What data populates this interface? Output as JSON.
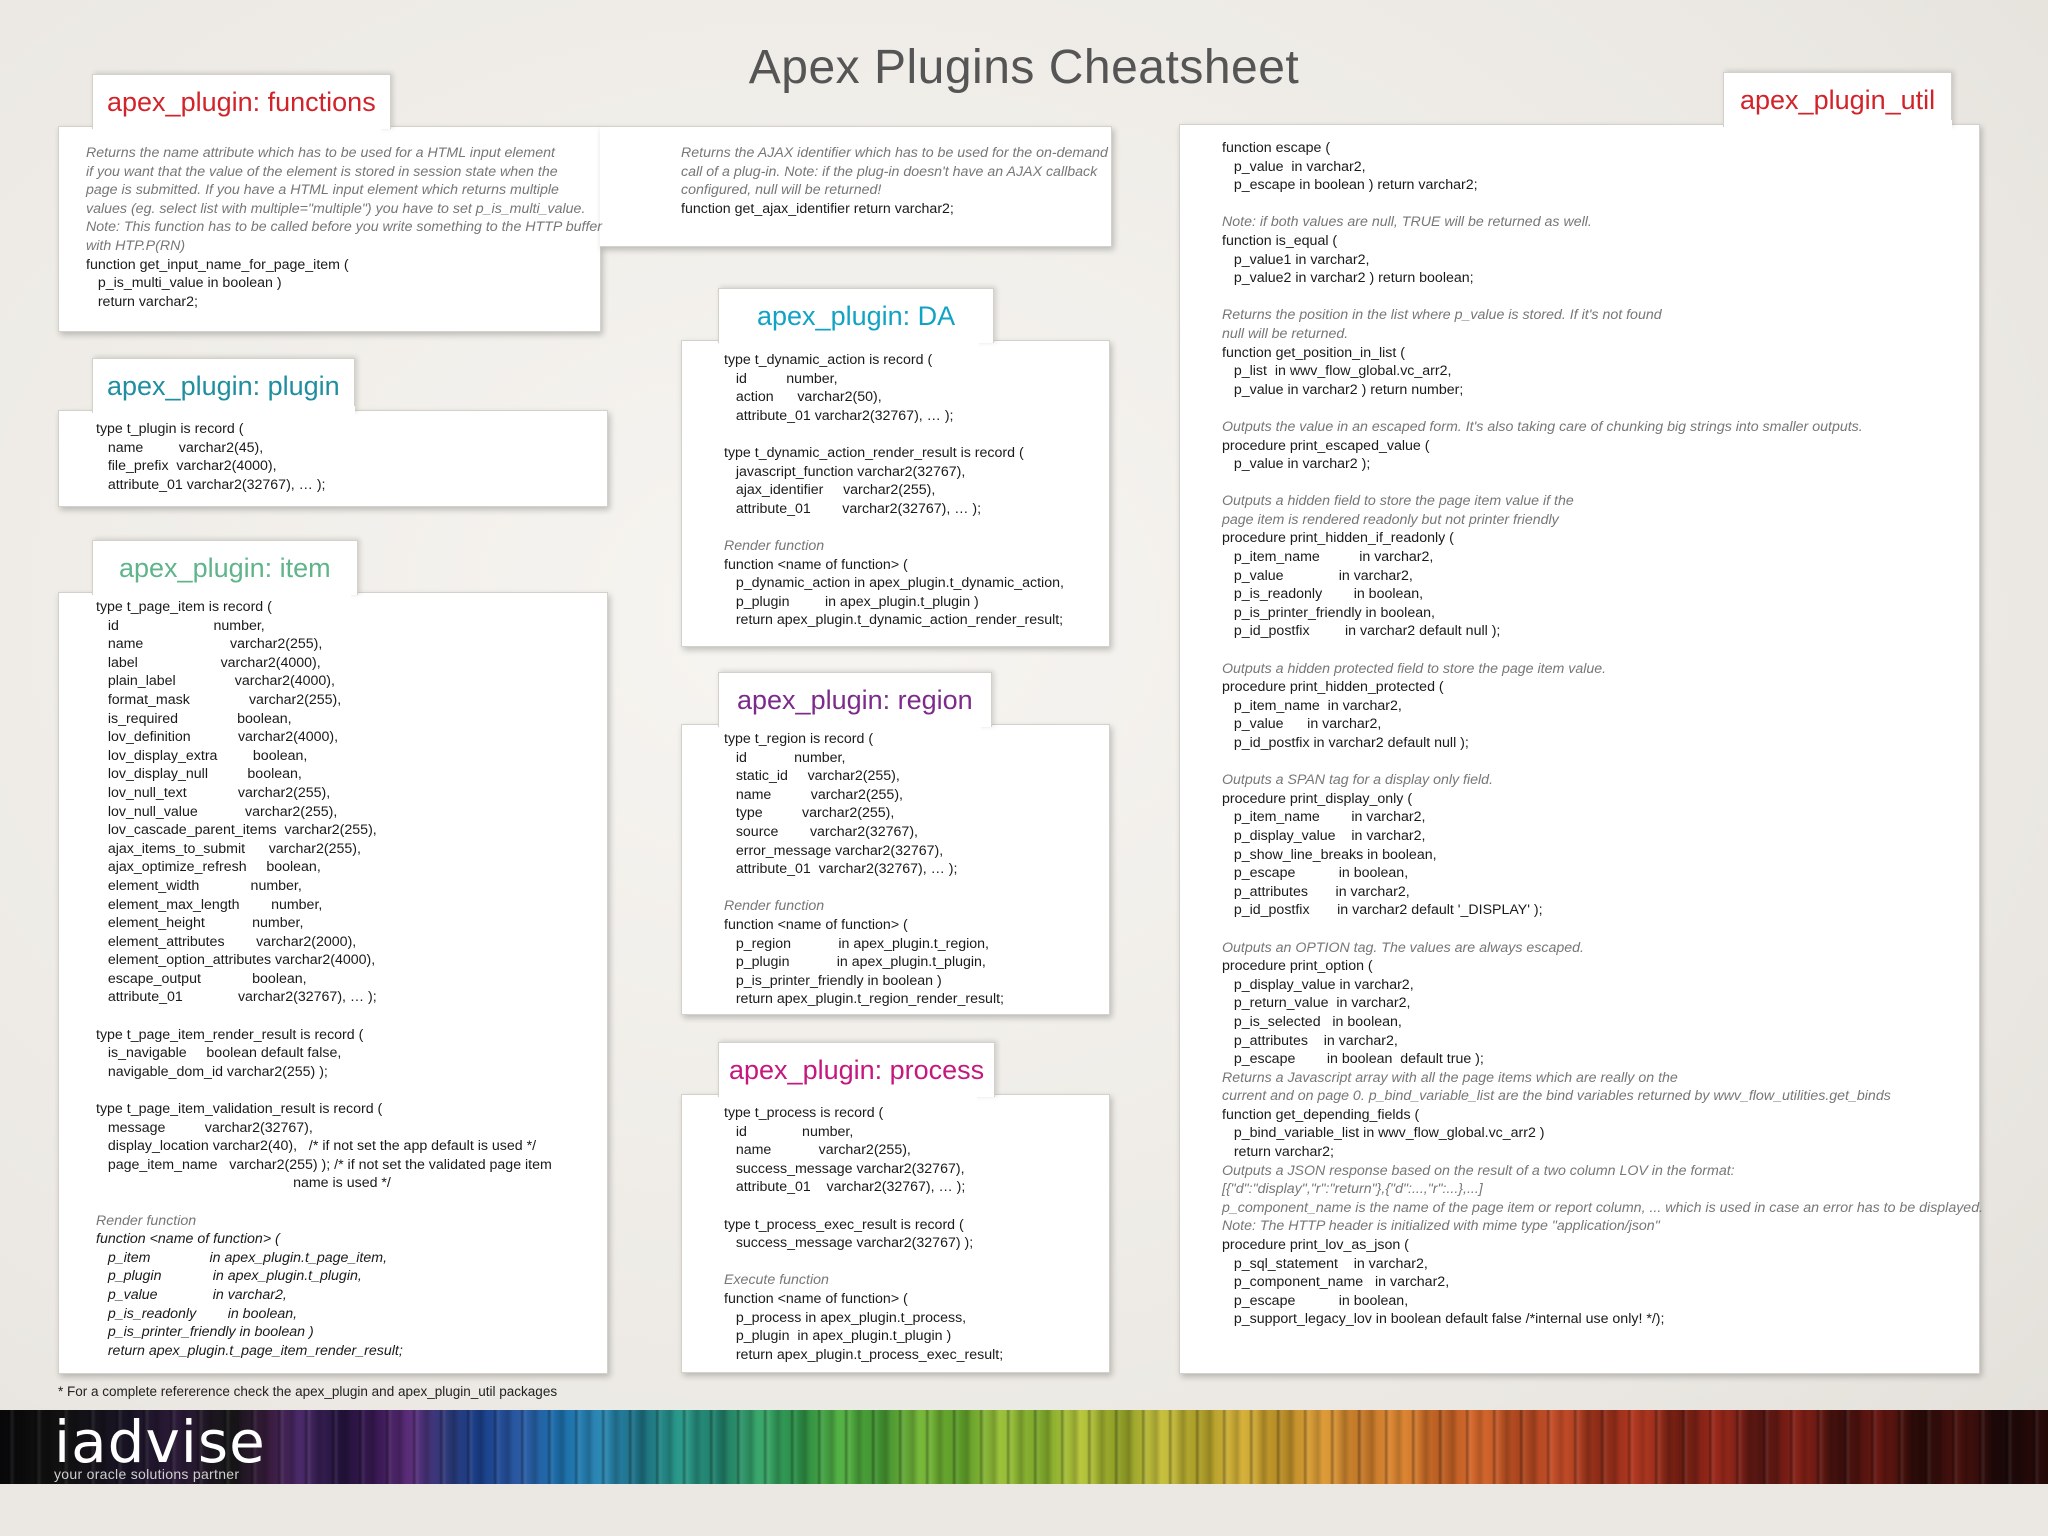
{
  "title": "Apex Plugins Cheatsheet",
  "colors": {
    "functions": "#d2232a",
    "plugin": "#1f8ea0",
    "item": "#5fb48a",
    "da": "#12a3c4",
    "region": "#7d2b8b",
    "process": "#c4187e",
    "util": "#d2232a"
  },
  "functions": {
    "tab": "apex_plugin: functions",
    "left_lines": [
      {
        "t": "Returns the name attribute which has to be used for a HTML input element",
        "s": "n"
      },
      {
        "t": "if you want that the value of the element is stored in session state when the",
        "s": "n"
      },
      {
        "t": "page is submitted. If you have a HTML input element which returns multiple",
        "s": "n"
      },
      {
        "t": "values (eg. select list with multiple=\"multiple\") you have to set p_is_multi_value.",
        "s": "n"
      },
      {
        "t": "Note: This function has to be called before you write something to the HTTP buffer",
        "s": "n"
      },
      {
        "t": "with HTP.P(RN)",
        "s": "n"
      },
      {
        "t": "function get_input_name_for_page_item (",
        "s": ""
      },
      {
        "t": "   p_is_multi_value in boolean )",
        "s": ""
      },
      {
        "t": "   return varchar2;",
        "s": ""
      }
    ],
    "right_lines": [
      {
        "t": "Returns the AJAX identifier which has to be used for the on-demand",
        "s": "n"
      },
      {
        "t": "call of a plug-in. Note: if the plug-in doesn't have an AJAX callback",
        "s": "n"
      },
      {
        "t": "configured, null will be returned!",
        "s": "n"
      },
      {
        "t": "function get_ajax_identifier return varchar2;",
        "s": ""
      }
    ]
  },
  "plugin": {
    "tab": "apex_plugin: plugin",
    "lines": [
      {
        "t": "type t_plugin is record (",
        "s": ""
      },
      {
        "t": "   name         varchar2(45),",
        "s": ""
      },
      {
        "t": "   file_prefix  varchar2(4000),",
        "s": ""
      },
      {
        "t": "   attribute_01 varchar2(32767), … );",
        "s": ""
      }
    ]
  },
  "item": {
    "tab": "apex_plugin: item",
    "lines": [
      {
        "t": "type t_page_item is record (",
        "s": ""
      },
      {
        "t": "   id                        number,",
        "s": ""
      },
      {
        "t": "   name                      varchar2(255),",
        "s": ""
      },
      {
        "t": "   label                     varchar2(4000),",
        "s": ""
      },
      {
        "t": "   plain_label               varchar2(4000),",
        "s": ""
      },
      {
        "t": "   format_mask               varchar2(255),",
        "s": ""
      },
      {
        "t": "   is_required               boolean,",
        "s": ""
      },
      {
        "t": "   lov_definition            varchar2(4000),",
        "s": ""
      },
      {
        "t": "   lov_display_extra         boolean,",
        "s": ""
      },
      {
        "t": "   lov_display_null          boolean,",
        "s": ""
      },
      {
        "t": "   lov_null_text             varchar2(255),",
        "s": ""
      },
      {
        "t": "   lov_null_value            varchar2(255),",
        "s": ""
      },
      {
        "t": "   lov_cascade_parent_items  varchar2(255),",
        "s": ""
      },
      {
        "t": "   ajax_items_to_submit      varchar2(255),",
        "s": ""
      },
      {
        "t": "   ajax_optimize_refresh     boolean,",
        "s": ""
      },
      {
        "t": "   element_width             number,",
        "s": ""
      },
      {
        "t": "   element_max_length        number,",
        "s": ""
      },
      {
        "t": "   element_height            number,",
        "s": ""
      },
      {
        "t": "   element_attributes        varchar2(2000),",
        "s": ""
      },
      {
        "t": "   element_option_attributes varchar2(4000),",
        "s": ""
      },
      {
        "t": "   escape_output             boolean,",
        "s": ""
      },
      {
        "t": "   attribute_01              varchar2(32767), … );",
        "s": ""
      },
      {
        "t": "",
        "s": ""
      },
      {
        "t": "type t_page_item_render_result is record (",
        "s": ""
      },
      {
        "t": "   is_navigable     boolean default false,",
        "s": ""
      },
      {
        "t": "   navigable_dom_id varchar2(255) );",
        "s": ""
      },
      {
        "t": "",
        "s": ""
      },
      {
        "t": "type t_page_item_validation_result is record (",
        "s": ""
      },
      {
        "t": "   message          varchar2(32767),",
        "s": ""
      },
      {
        "t": "   display_location varchar2(40),   /* if not set the app default is used */",
        "s": ""
      },
      {
        "t": "   page_item_name   varchar2(255) ); /* if not set the validated page item",
        "s": ""
      },
      {
        "t": "                                                  name is used */",
        "s": ""
      },
      {
        "t": "",
        "s": ""
      },
      {
        "t": "Render function",
        "s": "n"
      },
      {
        "t": "function <name of function> (",
        "s": "i"
      },
      {
        "t": "   p_item               in apex_plugin.t_page_item,",
        "s": "i"
      },
      {
        "t": "   p_plugin             in apex_plugin.t_plugin,",
        "s": "i"
      },
      {
        "t": "   p_value              in varchar2,",
        "s": "i"
      },
      {
        "t": "   p_is_readonly        in boolean,",
        "s": "i"
      },
      {
        "t": "   p_is_printer_friendly in boolean )",
        "s": "i"
      },
      {
        "t": "   return apex_plugin.t_page_item_render_result;",
        "s": "i"
      }
    ]
  },
  "da": {
    "tab": "apex_plugin: DA",
    "lines": [
      {
        "t": "type t_dynamic_action is record (",
        "s": ""
      },
      {
        "t": "   id          number,",
        "s": ""
      },
      {
        "t": "   action      varchar2(50),",
        "s": ""
      },
      {
        "t": "   attribute_01 varchar2(32767), … );",
        "s": ""
      },
      {
        "t": "",
        "s": ""
      },
      {
        "t": "type t_dynamic_action_render_result is record (",
        "s": ""
      },
      {
        "t": "   javascript_function varchar2(32767),",
        "s": ""
      },
      {
        "t": "   ajax_identifier     varchar2(255),",
        "s": ""
      },
      {
        "t": "   attribute_01        varchar2(32767), … );",
        "s": ""
      },
      {
        "t": "",
        "s": ""
      },
      {
        "t": "Render function",
        "s": "n"
      },
      {
        "t": "function <name of function> (",
        "s": ""
      },
      {
        "t": "   p_dynamic_action in apex_plugin.t_dynamic_action,",
        "s": ""
      },
      {
        "t": "   p_plugin         in apex_plugin.t_plugin )",
        "s": ""
      },
      {
        "t": "   return apex_plugin.t_dynamic_action_render_result;",
        "s": ""
      }
    ]
  },
  "region": {
    "tab": "apex_plugin: region",
    "lines": [
      {
        "t": "type t_region is record (",
        "s": ""
      },
      {
        "t": "   id            number,",
        "s": ""
      },
      {
        "t": "   static_id     varchar2(255),",
        "s": ""
      },
      {
        "t": "   name          varchar2(255),",
        "s": ""
      },
      {
        "t": "   type          varchar2(255),",
        "s": ""
      },
      {
        "t": "   source        varchar2(32767),",
        "s": ""
      },
      {
        "t": "   error_message varchar2(32767),",
        "s": ""
      },
      {
        "t": "   attribute_01  varchar2(32767), … );",
        "s": ""
      },
      {
        "t": "",
        "s": ""
      },
      {
        "t": "Render function",
        "s": "n"
      },
      {
        "t": "function <name of function> (",
        "s": ""
      },
      {
        "t": "   p_region            in apex_plugin.t_region,",
        "s": ""
      },
      {
        "t": "   p_plugin            in apex_plugin.t_plugin,",
        "s": ""
      },
      {
        "t": "   p_is_printer_friendly in boolean )",
        "s": ""
      },
      {
        "t": "   return apex_plugin.t_region_render_result;",
        "s": ""
      }
    ]
  },
  "process": {
    "tab": "apex_plugin: process",
    "lines": [
      {
        "t": "type t_process is record (",
        "s": ""
      },
      {
        "t": "   id              number,",
        "s": ""
      },
      {
        "t": "   name            varchar2(255),",
        "s": ""
      },
      {
        "t": "   success_message varchar2(32767),",
        "s": ""
      },
      {
        "t": "   attribute_01    varchar2(32767), … );",
        "s": ""
      },
      {
        "t": "",
        "s": ""
      },
      {
        "t": "type t_process_exec_result is record (",
        "s": ""
      },
      {
        "t": "   success_message varchar2(32767) );",
        "s": ""
      },
      {
        "t": "",
        "s": ""
      },
      {
        "t": "Execute function",
        "s": "n"
      },
      {
        "t": "function <name of function> (",
        "s": ""
      },
      {
        "t": "   p_process in apex_plugin.t_process,",
        "s": ""
      },
      {
        "t": "   p_plugin  in apex_plugin.t_plugin )",
        "s": ""
      },
      {
        "t": "   return apex_plugin.t_process_exec_result;",
        "s": ""
      }
    ]
  },
  "util": {
    "tab": "apex_plugin_util",
    "lines": [
      {
        "t": "function escape (",
        "s": ""
      },
      {
        "t": "   p_value  in varchar2,",
        "s": ""
      },
      {
        "t": "   p_escape in boolean ) return varchar2;",
        "s": ""
      },
      {
        "t": "",
        "s": ""
      },
      {
        "t": "Note: if both values are null, TRUE will be returned as well.",
        "s": "n"
      },
      {
        "t": "function is_equal (",
        "s": ""
      },
      {
        "t": "   p_value1 in varchar2,",
        "s": ""
      },
      {
        "t": "   p_value2 in varchar2 ) return boolean;",
        "s": ""
      },
      {
        "t": "",
        "s": ""
      },
      {
        "t": "Returns the position in the list where p_value is stored. If it's not found",
        "s": "n"
      },
      {
        "t": "null will be returned.",
        "s": "n"
      },
      {
        "t": "function get_position_in_list (",
        "s": ""
      },
      {
        "t": "   p_list  in wwv_flow_global.vc_arr2,",
        "s": ""
      },
      {
        "t": "   p_value in varchar2 ) return number;",
        "s": ""
      },
      {
        "t": "",
        "s": ""
      },
      {
        "t": "Outputs the value in an escaped form. It's also taking care of chunking big strings into smaller outputs.",
        "s": "n"
      },
      {
        "t": "procedure print_escaped_value (",
        "s": ""
      },
      {
        "t": "   p_value in varchar2 );",
        "s": ""
      },
      {
        "t": "",
        "s": ""
      },
      {
        "t": "Outputs a hidden field to store the page item value if the",
        "s": "n"
      },
      {
        "t": "page item is rendered readonly but not printer friendly",
        "s": "n"
      },
      {
        "t": "procedure print_hidden_if_readonly (",
        "s": ""
      },
      {
        "t": "   p_item_name          in varchar2,",
        "s": ""
      },
      {
        "t": "   p_value              in varchar2,",
        "s": ""
      },
      {
        "t": "   p_is_readonly        in boolean,",
        "s": ""
      },
      {
        "t": "   p_is_printer_friendly in boolean,",
        "s": ""
      },
      {
        "t": "   p_id_postfix         in varchar2 default null );",
        "s": ""
      },
      {
        "t": "",
        "s": ""
      },
      {
        "t": "Outputs a hidden protected field to store the page item value.",
        "s": "n"
      },
      {
        "t": "procedure print_hidden_protected (",
        "s": ""
      },
      {
        "t": "   p_item_name  in varchar2,",
        "s": ""
      },
      {
        "t": "   p_value      in varchar2,",
        "s": ""
      },
      {
        "t": "   p_id_postfix in varchar2 default null );",
        "s": ""
      },
      {
        "t": "",
        "s": ""
      },
      {
        "t": "Outputs a SPAN tag for a display only field.",
        "s": "n"
      },
      {
        "t": "procedure print_display_only (",
        "s": ""
      },
      {
        "t": "   p_item_name        in varchar2,",
        "s": ""
      },
      {
        "t": "   p_display_value    in varchar2,",
        "s": ""
      },
      {
        "t": "   p_show_line_breaks in boolean,",
        "s": ""
      },
      {
        "t": "   p_escape           in boolean,",
        "s": ""
      },
      {
        "t": "   p_attributes       in varchar2,",
        "s": ""
      },
      {
        "t": "   p_id_postfix       in varchar2 default '_DISPLAY' );",
        "s": ""
      },
      {
        "t": "",
        "s": ""
      },
      {
        "t": "Outputs an OPTION tag. The values are always escaped.",
        "s": "n"
      },
      {
        "t": "procedure print_option (",
        "s": ""
      },
      {
        "t": "   p_display_value in varchar2,",
        "s": ""
      },
      {
        "t": "   p_return_value  in varchar2,",
        "s": ""
      },
      {
        "t": "   p_is_selected   in boolean,",
        "s": ""
      },
      {
        "t": "   p_attributes    in varchar2,",
        "s": ""
      },
      {
        "t": "   p_escape        in boolean  default true );",
        "s": ""
      },
      {
        "t": "Returns a Javascript array with all the page items which are really on the",
        "s": "n"
      },
      {
        "t": "current and on page 0. p_bind_variable_list are the bind variables returned by wwv_flow_utilities.get_binds",
        "s": "n"
      },
      {
        "t": "function get_depending_fields (",
        "s": ""
      },
      {
        "t": "   p_bind_variable_list in wwv_flow_global.vc_arr2 )",
        "s": ""
      },
      {
        "t": "   return varchar2;",
        "s": ""
      },
      {
        "t": "Outputs a JSON response based on the result of a two column LOV in the format:",
        "s": "n"
      },
      {
        "t": "[{\"d\":\"display\",\"r\":\"return\"},{\"d\":...,\"r\":...},...]",
        "s": "n"
      },
      {
        "t": "p_component_name is the name of the page item or report column, ... which is used in case an error has to be displayed.",
        "s": "n"
      },
      {
        "t": "Note: The HTTP header is initialized with mime type \"application/json\"",
        "s": "n"
      },
      {
        "t": "procedure print_lov_as_json (",
        "s": ""
      },
      {
        "t": "   p_sql_statement    in varchar2,",
        "s": ""
      },
      {
        "t": "   p_component_name   in varchar2,",
        "s": ""
      },
      {
        "t": "   p_escape           in boolean,",
        "s": ""
      },
      {
        "t": "   p_support_legacy_lov in boolean default false /*internal use only! */);",
        "s": ""
      }
    ]
  },
  "footnote": "* For a complete refererence check the apex_plugin and apex_plugin_util packages",
  "logo": {
    "word": "iadvise",
    "tagline": "your oracle solutions partner"
  }
}
